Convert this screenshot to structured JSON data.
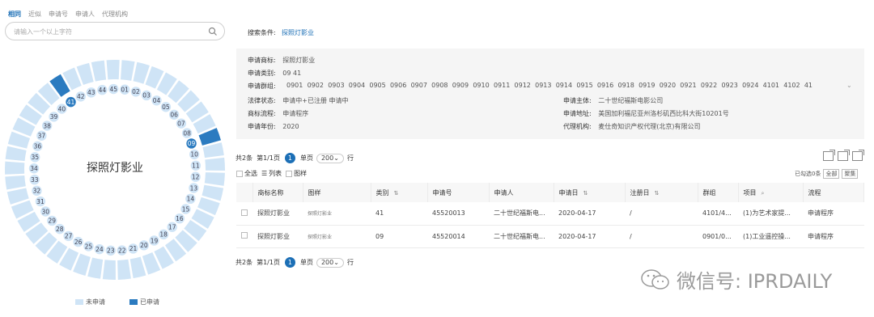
{
  "tabs": [
    "相同",
    "近似",
    "申请号",
    "申请人",
    "代理机构"
  ],
  "search": {
    "placeholder": "请输入一个以上字符"
  },
  "ring": {
    "center_text": "探照灯影业",
    "classes": [
      "01",
      "02",
      "03",
      "04",
      "05",
      "06",
      "07",
      "08",
      "09",
      "10",
      "11",
      "12",
      "13",
      "14",
      "15",
      "16",
      "17",
      "18",
      "19",
      "20",
      "21",
      "22",
      "23",
      "24",
      "25",
      "26",
      "27",
      "28",
      "29",
      "30",
      "31",
      "32",
      "33",
      "34",
      "35",
      "36",
      "37",
      "38",
      "39",
      "40",
      "41",
      "42",
      "43",
      "44",
      "45"
    ],
    "applied": [
      "09",
      "41"
    ],
    "colors": {
      "not_applied": "#cfe4f6",
      "applied": "#2b7bc0"
    }
  },
  "legend": {
    "not_applied": "未申请",
    "applied": "已申请"
  },
  "condition": {
    "label": "搜索条件:",
    "value": "探照灯影业"
  },
  "info": {
    "mark_label": "申请商标:",
    "mark_value": "探照灯影业",
    "class_label": "申请类别:",
    "class_value": "09  41",
    "group_label": "申请群组:",
    "groups": [
      "0901",
      "0902",
      "0903",
      "0904",
      "0905",
      "0906",
      "0907",
      "0908",
      "0909",
      "0910",
      "0911",
      "0912",
      "0913",
      "0914",
      "0915",
      "0916",
      "0918",
      "0919",
      "0920",
      "0921",
      "0922",
      "0923",
      "0924",
      "4101",
      "4102",
      "41"
    ],
    "law_label": "法律状态:",
    "law_value": "申请中+已注册  申请中",
    "process_label": "商标流程:",
    "process_value": "申请程序",
    "year_label": "申请年份:",
    "year_value": "2020",
    "owner_label": "申请主体:",
    "owner_value": "二十世纪福斯电影公司",
    "addr_label": "申请地址:",
    "addr_value": "美国加利福尼亚州洛杉矶西比科大街10201号",
    "agent_label": "代理机构:",
    "agent_value": "麦仕奇知识产权代理(北京)有限公司"
  },
  "pager": {
    "total": "共2条",
    "page": "第1/1页",
    "current": "1",
    "per_page_label": "单页",
    "per_page": "200",
    "unit": "行"
  },
  "toolbar": {
    "select_all": "全选",
    "list": "列表",
    "image": "图样",
    "selected": "已勾选0条",
    "all_chip": "全部",
    "chip2": "聚集"
  },
  "table": {
    "headers": [
      "商标名称",
      "图样",
      "类别",
      "申请号",
      "申请人",
      "申请日",
      "注册日",
      "群组",
      "项目",
      "流程"
    ],
    "rows": [
      [
        "探照灯影业",
        "探照灯影业",
        "41",
        "45520013",
        "二十世纪福斯电...",
        "2020-04-17",
        "/",
        "4101/4...",
        "(1)为艺术家提...",
        "申请程序"
      ],
      [
        "探照灯影业",
        "探照灯影业",
        "09",
        "45520014",
        "二十世纪福斯电...",
        "2020-04-17",
        "/",
        "0901/0...",
        "(1)工业遥控操...",
        "申请程序"
      ]
    ]
  },
  "watermark": "微信号: IPRDAILY"
}
